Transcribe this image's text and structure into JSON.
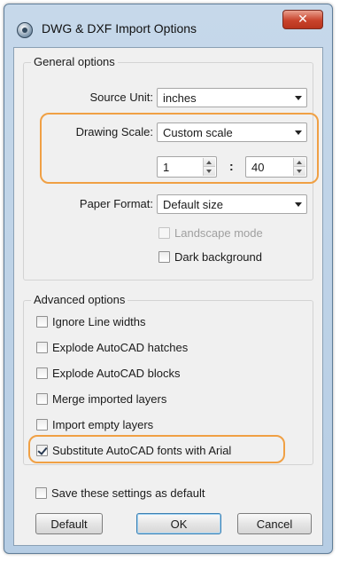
{
  "window": {
    "title": "DWG & DXF Import Options",
    "close_label": "✕"
  },
  "general": {
    "legend": "General options",
    "source_unit": {
      "label": "Source Unit:",
      "value": "inches"
    },
    "drawing_scale": {
      "label": "Drawing Scale:",
      "value": "Custom scale"
    },
    "scale_left": "1",
    "scale_sep": ":",
    "scale_right": "40",
    "paper_format": {
      "label": "Paper Format:",
      "value": "Default size"
    },
    "landscape_mode": {
      "label": "Landscape mode",
      "checked": false,
      "enabled": false
    },
    "dark_background": {
      "label": "Dark background",
      "checked": false,
      "enabled": true
    }
  },
  "advanced": {
    "legend": "Advanced options",
    "items": [
      {
        "label": "Ignore Line widths",
        "checked": false
      },
      {
        "label": "Explode AutoCAD hatches",
        "checked": false
      },
      {
        "label": "Explode AutoCAD blocks",
        "checked": false
      },
      {
        "label": "Merge imported layers",
        "checked": false
      },
      {
        "label": "Import empty layers",
        "checked": false
      },
      {
        "label": "Substitute AutoCAD fonts with Arial",
        "checked": true
      }
    ]
  },
  "save_default": {
    "label": "Save these settings as default",
    "checked": false
  },
  "buttons": {
    "default": "Default",
    "ok": "OK",
    "cancel": "Cancel"
  },
  "colors": {
    "highlight": "#f0a044",
    "title_bar": "#c6d8ea",
    "close": "#c9432c"
  }
}
